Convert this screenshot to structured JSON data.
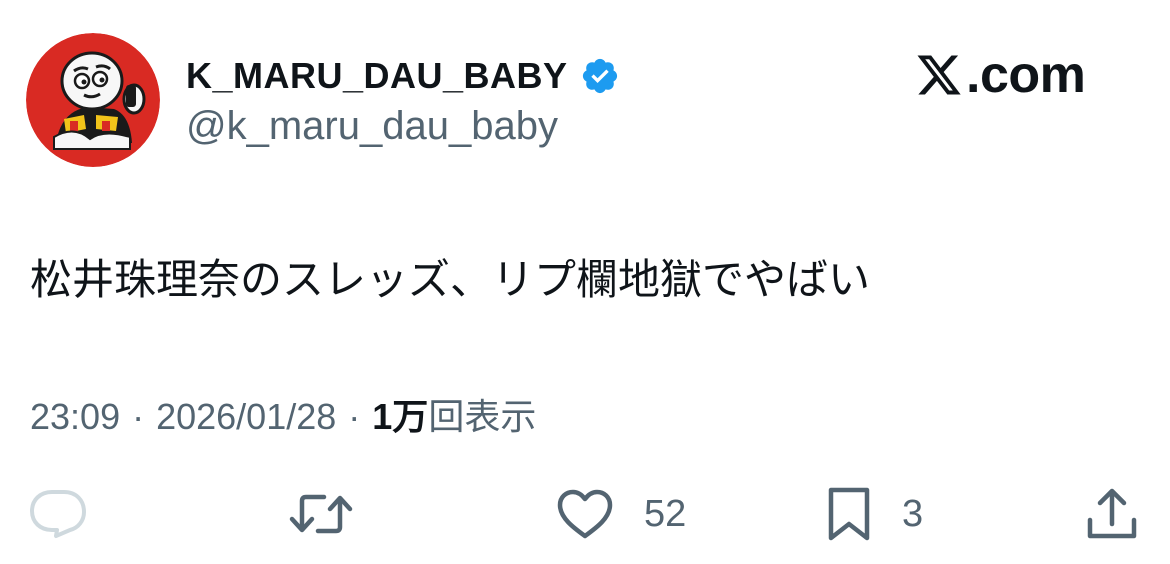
{
  "user": {
    "display_name": "K_MARU_DAU_BABY",
    "handle": "@k_maru_dau_baby",
    "verified_icon": "verified-badge-icon",
    "avatar_icon": "mascot-avatar-icon"
  },
  "site": {
    "logo_icon": "x-logo-icon",
    "label": ".com"
  },
  "tweet": {
    "text": "松井珠理奈のスレッズ、リプ欄地獄でやばい"
  },
  "meta": {
    "time": "23:09",
    "separator": "·",
    "date": "2026/01/28",
    "views_count": "1万",
    "views_label": "回表示"
  },
  "actions": {
    "reply": {
      "icon": "reply-icon"
    },
    "retweet": {
      "icon": "retweet-icon"
    },
    "like": {
      "icon": "heart-icon",
      "count": "52"
    },
    "bookmark": {
      "icon": "bookmark-icon",
      "count": "3"
    },
    "share": {
      "icon": "share-icon"
    }
  },
  "colors": {
    "text_primary": "#0f1419",
    "text_secondary": "#536471",
    "verified_blue": "#1d9bf0",
    "avatar_red": "#d92a23"
  }
}
